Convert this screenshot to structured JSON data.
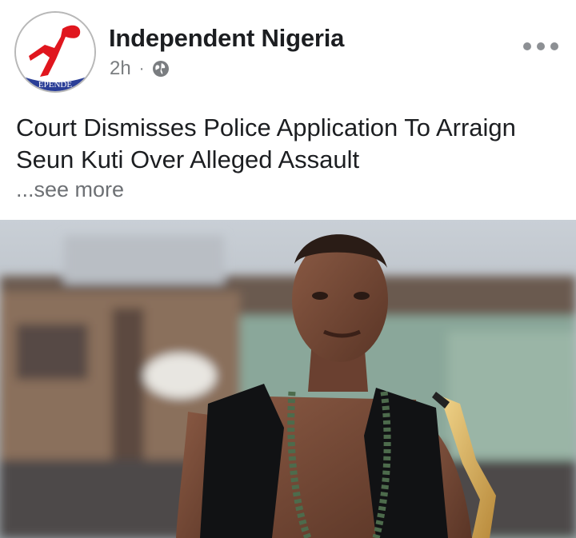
{
  "post": {
    "page_name": "Independent Nigeria",
    "time": "2h",
    "separator": "·",
    "privacy_icon": "globe-icon",
    "more_icon": "more-options-icon",
    "text": "Court Dismisses Police Application To Arraign Seun Kuti Over Alleged Assault",
    "see_more": "...see more",
    "logo_text": "EPENDE"
  },
  "colors": {
    "brand_red": "#e0161e",
    "brand_blue": "#2a3e97",
    "meta_gray": "#7a7d80"
  }
}
